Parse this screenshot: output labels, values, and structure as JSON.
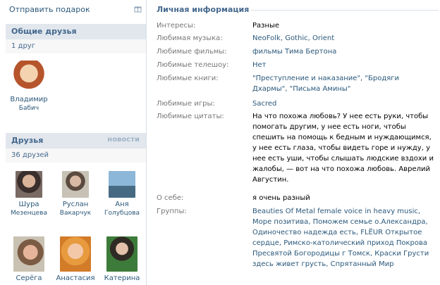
{
  "left": {
    "gift_label": "Отправить подарок",
    "common_friends": {
      "title": "Общие друзья",
      "count": "1 друг",
      "items": [
        {
          "first": "Владимир",
          "last": "Бабич"
        }
      ]
    },
    "friends": {
      "title": "Друзья",
      "more": "новости",
      "count": "36 друзей",
      "items": [
        {
          "first": "Шура",
          "last": "Мезенцева"
        },
        {
          "first": "Руслан",
          "last": "Вакарчук"
        },
        {
          "first": "Аня",
          "last": "Голубцова"
        },
        {
          "first": "Серёга",
          "last": ""
        },
        {
          "first": "Анастасия",
          "last": ""
        },
        {
          "first": "Катерина",
          "last": ""
        }
      ]
    }
  },
  "info": {
    "title": "Личная информация",
    "rows": [
      {
        "label": "Интересы:",
        "value": "Разные"
      },
      {
        "label": "Любимая музыка:",
        "value": "NeoFolk, Gothic, Orient"
      },
      {
        "label": "Любимые фильмы:",
        "value": "фильмы Тима Бертона"
      },
      {
        "label": "Любимые телешоу:",
        "value": "Нет"
      },
      {
        "label": "Любимые книги:",
        "value": "\"Преступление и наказание\", \"Бродяги Дхармы\", \"Письма Амины\""
      },
      {
        "label": "Любимые игры:",
        "value": "Sacred"
      },
      {
        "label": "Любимые цитаты:",
        "value": "На что похожа любовь? У нее есть руки, чтобы помогать другим, у нее есть ноги, чтобы спешить на помощь к бедным и нуждающимся, у нее есть глаза, чтобы видеть горе и нужду, у нее есть уши, чтобы слышать людские вздохи и жалобы, — вот на что похожа любовь. Аврелий Августин."
      },
      {
        "label": "О себе:",
        "value": "я очень разный"
      },
      {
        "label": "Группы:",
        "value": "Beauties Of Metal female voice in heavy music, Море позитива, Поможем семье о.Александра, Одиночество надежда есть, FLËUR Открытое сердце, Римско-католический приход Покрова Пресвятой Богородицы г Томск, Краски Грусти здесь живет грусть, Спрятанный Мир"
      }
    ]
  }
}
